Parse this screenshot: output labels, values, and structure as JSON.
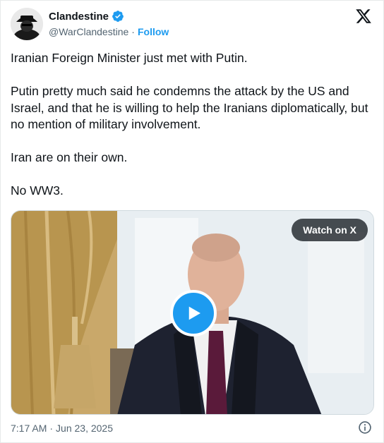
{
  "author": {
    "display_name": "Clandestine",
    "handle": "@WarClandestine",
    "separator": "·",
    "follow_label": "Follow",
    "verified_icon": "verified-badge-icon",
    "avatar_icon": "avatar"
  },
  "brand": {
    "logo_icon": "x-logo-icon"
  },
  "tweet": {
    "paragraphs": [
      "Iranian Foreign Minister just met with Putin.",
      "Putin pretty much said he condemns the attack by the US and Israel, and that he is willing to help the Iranians diplomatically, but no mention of military involvement.",
      "Iran are on their own.",
      "No WW3."
    ]
  },
  "media": {
    "watch_label": "Watch on X",
    "play_icon": "play-icon"
  },
  "footer": {
    "time": "7:17 AM",
    "separator": "·",
    "date": "Jun 23, 2025",
    "info_icon": "info-icon"
  },
  "colors": {
    "accent": "#1d9bf0",
    "text": "#0f1419",
    "secondary_text": "#536471"
  }
}
